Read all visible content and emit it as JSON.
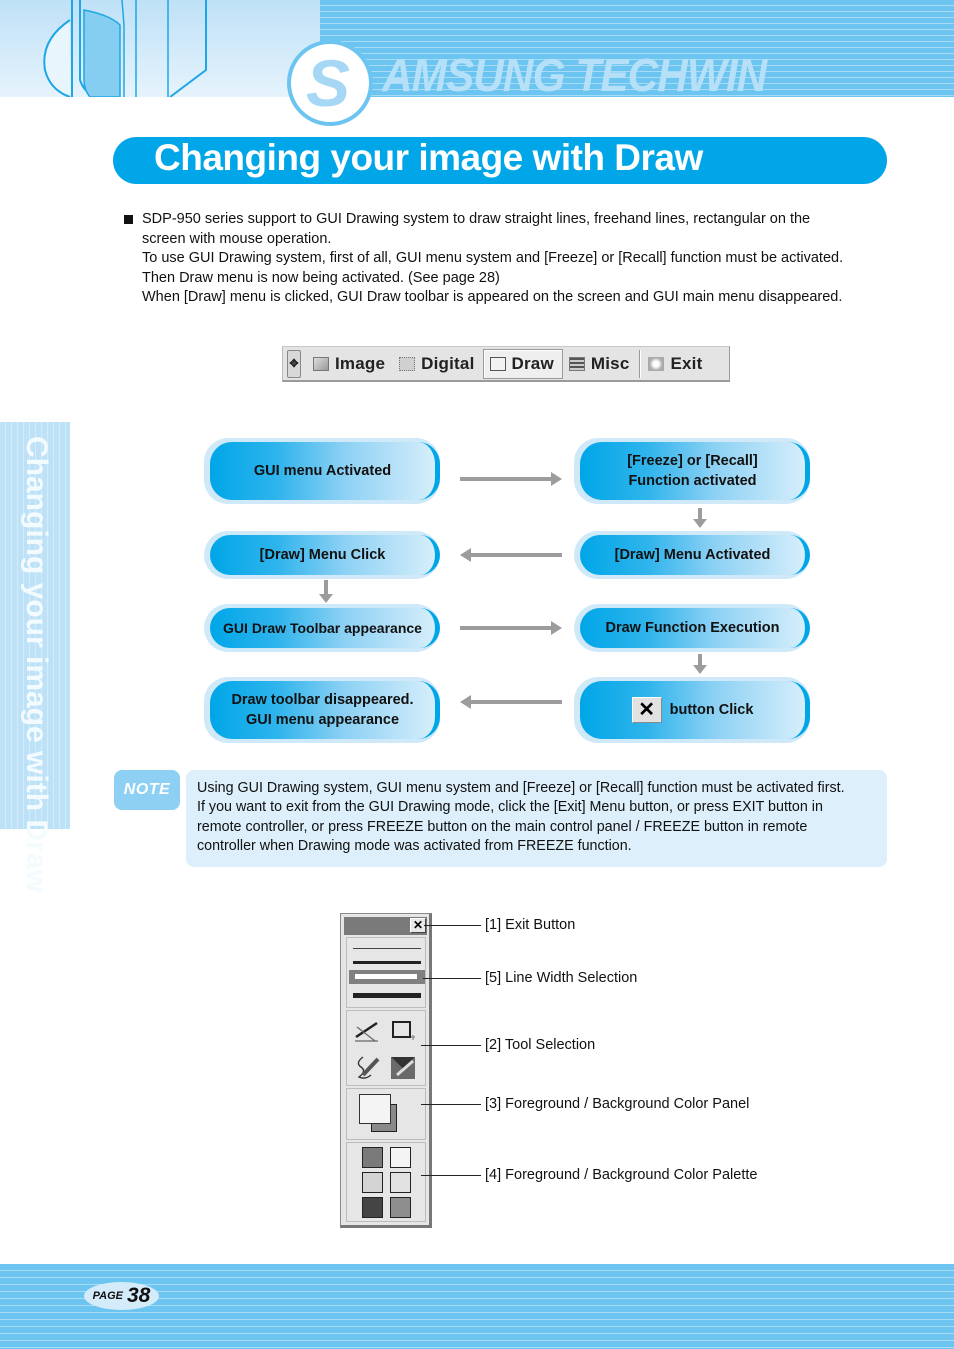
{
  "header": {
    "brand_initial": "S",
    "brand_text": "AMSUNG TECHWIN",
    "colors": {
      "stripe": "#6cc4f0",
      "accent": "#00a6e8",
      "light": "#bde2f7"
    }
  },
  "title": "Changing your image with Draw",
  "side_tab": "Changing your image with Draw",
  "intro": {
    "lines": [
      "SDP-950 series support to GUI Drawing system to draw straight lines, freehand lines, rectangular on the",
      "screen with mouse operation.",
      "To use GUI Drawing system, first of all, GUI menu system and [Freeze] or [Recall] function must be activated.",
      "Then Draw menu is now being activated. (See page 28)",
      "When [Draw] menu is clicked, GUI Draw toolbar is appeared on the screen and GUI main menu disappeared."
    ]
  },
  "menubar": {
    "grip_icon": "move-handle-icon",
    "items": [
      {
        "label": "Image",
        "icon": "image-icon",
        "active": false
      },
      {
        "label": "Digital",
        "icon": "digital-icon",
        "active": false
      },
      {
        "label": "Draw",
        "icon": "draw-icon",
        "active": true
      },
      {
        "label": "Misc",
        "icon": "misc-icon",
        "active": false
      },
      {
        "label": "Exit",
        "icon": "exit-icon",
        "active": false
      }
    ]
  },
  "flowchart": {
    "steps": [
      {
        "id": "gui-menu-activated",
        "lines": [
          "GUI menu Activated"
        ]
      },
      {
        "id": "freeze-recall-activated",
        "lines": [
          "[Freeze] or [Recall]",
          "Function activated"
        ]
      },
      {
        "id": "draw-menu-activated",
        "lines": [
          "[Draw] Menu Activated"
        ]
      },
      {
        "id": "draw-menu-click",
        "lines": [
          "[Draw] Menu Click"
        ]
      },
      {
        "id": "gui-draw-toolbar-appearance",
        "lines": [
          "GUI Draw Toolbar appearance"
        ]
      },
      {
        "id": "draw-function-execution",
        "lines": [
          "Draw Function Execution"
        ]
      },
      {
        "id": "x-button-click",
        "lines": [
          "button Click"
        ],
        "icon": "close-x-icon",
        "icon_glyph": "✕"
      },
      {
        "id": "draw-toolbar-disappeared",
        "lines": [
          "Draw toolbar disappeared.",
          "GUI menu appearance"
        ]
      }
    ],
    "arrow_color": "#9c9c9c"
  },
  "note": {
    "badge": "NOTE",
    "lines": [
      "Using GUI Drawing system, GUI menu system and [Freeze] or [Recall] function must be activated first.",
      "If you want to exit from the GUI Drawing mode, click the [Exit] Menu button, or press EXIT button in",
      "remote controller, or press FREEZE button on the main control panel / FREEZE button in remote",
      "controller  when Drawing mode was activated from FREEZE function."
    ]
  },
  "draw_toolbar": {
    "close_glyph": "✕",
    "line_widths": [
      "thin",
      "medium",
      "selected",
      "thick"
    ],
    "tools": [
      "line-tool",
      "rectangle-tool",
      "freehand-tool",
      "eraser-tool"
    ],
    "foreground_color": "#f4f4f4",
    "background_color": "#8a8a8a",
    "palette": [
      "#7a7a7a",
      "#f4f4f4",
      "#d4d4d4",
      "#e2e2e2",
      "#444444",
      "#8e8e8e"
    ]
  },
  "callouts": [
    {
      "num": "[1]",
      "label": "[1] Exit Button"
    },
    {
      "num": "[5]",
      "label": "[5] Line Width Selection"
    },
    {
      "num": "[2]",
      "label": "[2] Tool Selection"
    },
    {
      "num": "[3]",
      "label": "[3] Foreground / Background Color Panel"
    },
    {
      "num": "[4]",
      "label": "[4] Foreground / Background Color Palette"
    }
  ],
  "footer": {
    "page_word": "PAGE",
    "page_number": "38"
  }
}
